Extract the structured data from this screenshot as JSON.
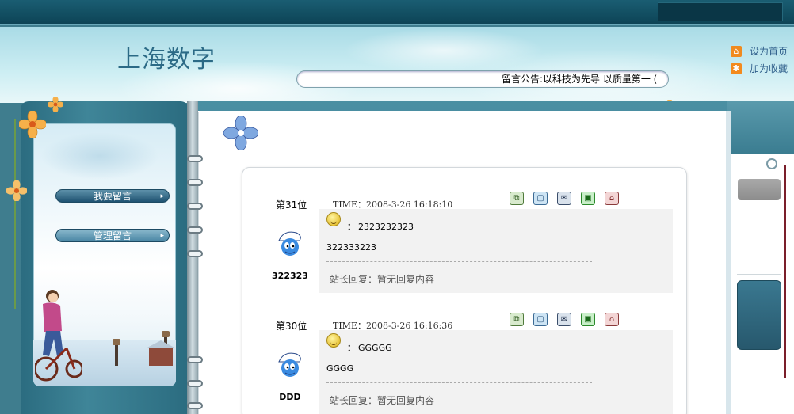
{
  "header": {
    "site_title": "上海数字",
    "links": [
      {
        "label": "设为首页",
        "icon": "home-icon"
      },
      {
        "label": "加为收藏",
        "icon": "bookmark-icon"
      }
    ],
    "notice": "留言公告:以科技为先导 以质量第一 (",
    "colors": {
      "top_bar": "#0d4456",
      "sky": "#bfe6ee",
      "title": "#2b6a86"
    }
  },
  "sidebar": {
    "items": [
      {
        "label": "我要留言",
        "icon": "chevron-right-icon"
      },
      {
        "label": "管理留言",
        "icon": "chevron-right-icon"
      }
    ]
  },
  "entries": [
    {
      "floor": "第31位",
      "time_label": "TIME：",
      "time": "2008-3-26 16:18:10",
      "user": "322323",
      "avatar": "smurf-avatar",
      "title_prefix": "：",
      "title": "2323232323",
      "content": "322333223",
      "reply_label": "站长回复：",
      "reply": "暂无回复内容",
      "actions": [
        "copy-icon",
        "edit-icon",
        "mail-icon",
        "view-icon",
        "home-icon"
      ]
    },
    {
      "floor": "第30位",
      "time_label": "TIME：",
      "time": "2008-3-26 16:16:36",
      "user": "DDD",
      "avatar": "smurf-avatar",
      "title_prefix": "：",
      "title": "GGGGG",
      "content": "GGGG",
      "reply_label": "站长回复：",
      "reply": "暂无回复内容",
      "actions": [
        "copy-icon",
        "edit-icon",
        "mail-icon",
        "view-icon",
        "home-icon"
      ]
    }
  ]
}
